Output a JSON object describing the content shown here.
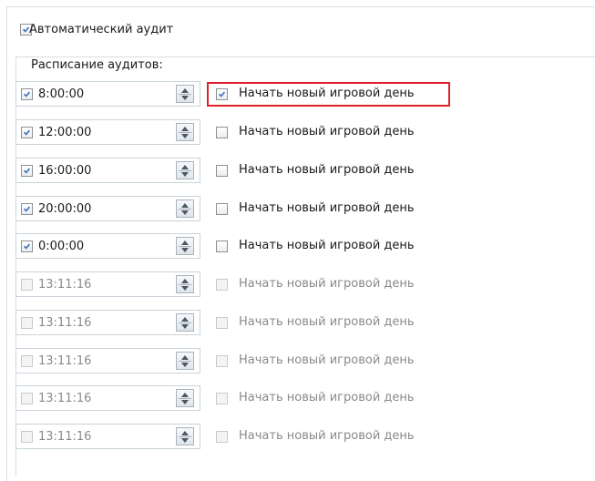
{
  "auto_audit": {
    "label": "Автоматический аудит",
    "checked": true
  },
  "schedule": {
    "legend": "Расписание аудитов:",
    "rows": [
      {
        "time": "8:00:00",
        "time_checked": true,
        "enabled": true,
        "newday_label": "Начать новый игровой день",
        "newday_checked": true,
        "highlighted": true
      },
      {
        "time": "12:00:00",
        "time_checked": true,
        "enabled": true,
        "newday_label": "Начать новый игровой день",
        "newday_checked": false,
        "highlighted": false
      },
      {
        "time": "16:00:00",
        "time_checked": true,
        "enabled": true,
        "newday_label": "Начать новый игровой день",
        "newday_checked": false,
        "highlighted": false
      },
      {
        "time": "20:00:00",
        "time_checked": true,
        "enabled": true,
        "newday_label": "Начать новый игровой день",
        "newday_checked": false,
        "highlighted": false
      },
      {
        "time": "0:00:00",
        "time_checked": true,
        "enabled": true,
        "newday_label": "Начать новый игровой день",
        "newday_checked": false,
        "highlighted": false
      },
      {
        "time": "13:11:16",
        "time_checked": false,
        "enabled": false,
        "newday_label": "Начать новый игровой день",
        "newday_checked": false,
        "highlighted": false
      },
      {
        "time": "13:11:16",
        "time_checked": false,
        "enabled": false,
        "newday_label": "Начать новый игровой день",
        "newday_checked": false,
        "highlighted": false
      },
      {
        "time": "13:11:16",
        "time_checked": false,
        "enabled": false,
        "newday_label": "Начать новый игровой день",
        "newday_checked": false,
        "highlighted": false
      },
      {
        "time": "13:11:16",
        "time_checked": false,
        "enabled": false,
        "newday_label": "Начать новый игровой день",
        "newday_checked": false,
        "highlighted": false
      },
      {
        "time": "13:11:16",
        "time_checked": false,
        "enabled": false,
        "newday_label": "Начать новый игровой день",
        "newday_checked": false,
        "highlighted": false
      }
    ]
  },
  "colors": {
    "accent_check": "#3d6fb8",
    "highlight": "#e0202a",
    "disabled_text": "#8a8a8a"
  },
  "icons": {
    "checkbox": "checkbox-icon",
    "spinner": "spinner-updown-icon"
  }
}
